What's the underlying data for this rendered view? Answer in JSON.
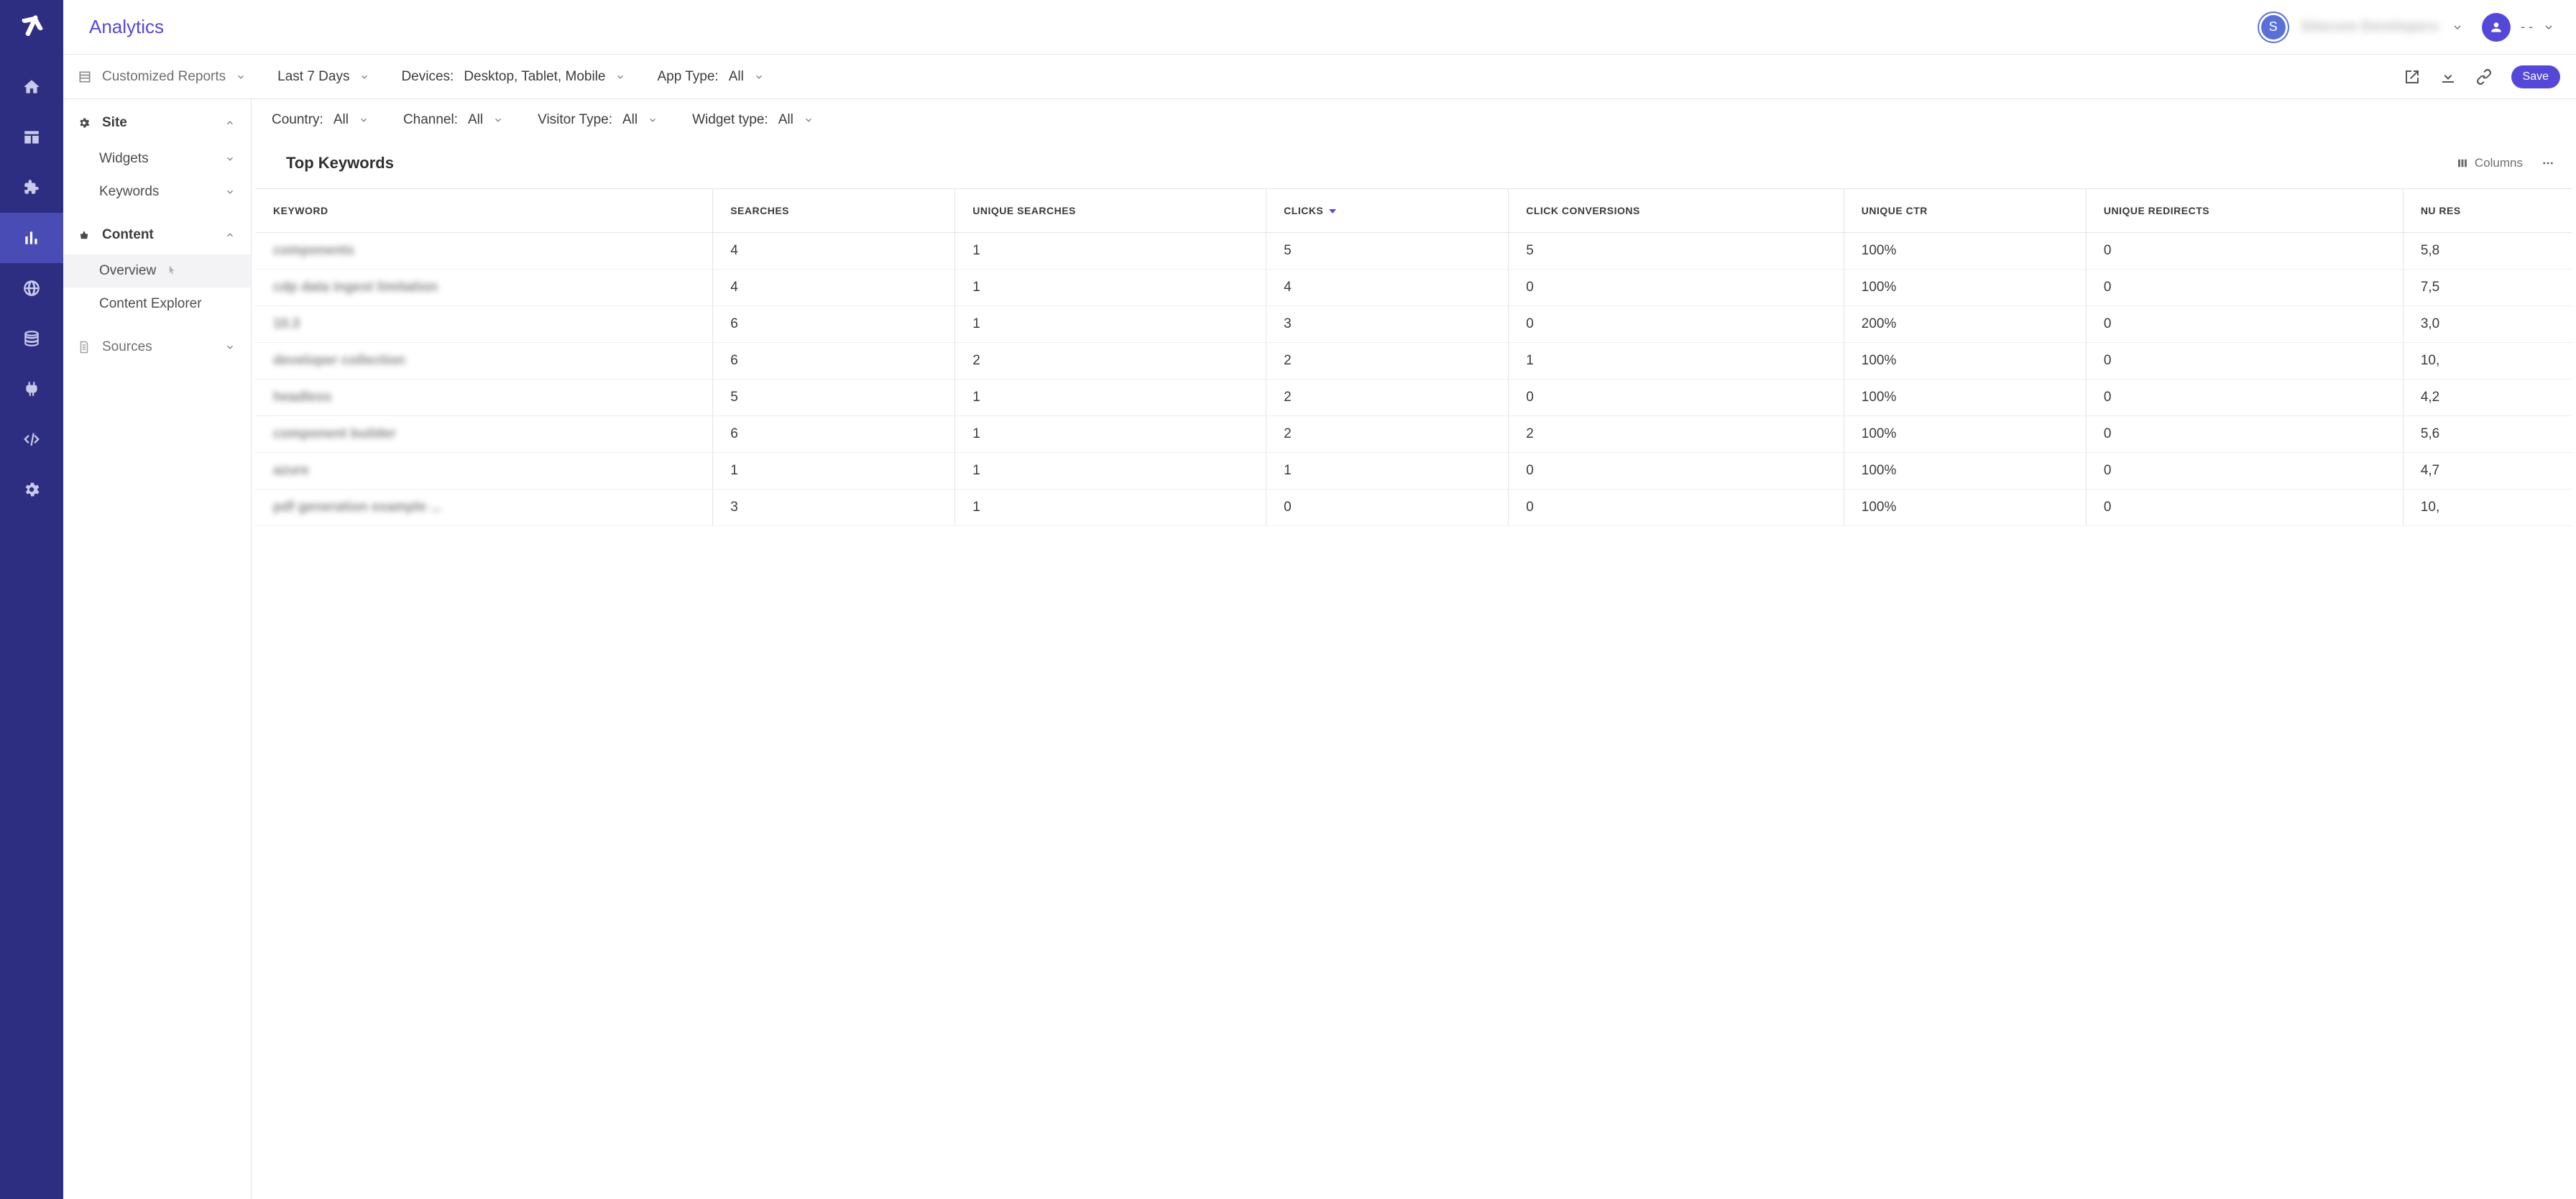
{
  "header": {
    "title": "Analytics",
    "avatar_letter": "S",
    "org_name": "Sitecore Developers",
    "user_label": "- -"
  },
  "toolbar": {
    "reports_label": "Customized Reports",
    "daterange": "Last 7 Days",
    "devices_label": "Devices:",
    "devices_value": "Desktop, Tablet, Mobile",
    "apptype_label": "App Type:",
    "apptype_value": "All",
    "save_label": "Save"
  },
  "sidebar": {
    "site": "Site",
    "widgets": "Widgets",
    "keywords": "Keywords",
    "content": "Content",
    "overview": "Overview",
    "content_explorer": "Content Explorer",
    "sources": "Sources"
  },
  "filters": {
    "country_label": "Country:",
    "country_value": "All",
    "channel_label": "Channel:",
    "channel_value": "All",
    "visitor_label": "Visitor Type:",
    "visitor_value": "All",
    "widget_label": "Widget type:",
    "widget_value": "All"
  },
  "panel": {
    "title": "Top Keywords",
    "columns_label": "Columns"
  },
  "table": {
    "headers": {
      "keyword": "KEYWORD",
      "searches": "SEARCHES",
      "unique_searches": "UNIQUE SEARCHES",
      "clicks": "CLICKS",
      "click_conversions": "CLICK CONVERSIONS",
      "unique_ctr": "UNIQUE CTR",
      "unique_redirects": "UNIQUE REDIRECTS",
      "nu_res": "NU RES"
    },
    "rows": [
      {
        "keyword": "components",
        "searches": "4",
        "unique_searches": "1",
        "clicks": "5",
        "click_conversions": "5",
        "unique_ctr": "100%",
        "unique_redirects": "0",
        "nu_res": "5,8"
      },
      {
        "keyword": "cdp data ingest limitation",
        "searches": "4",
        "unique_searches": "1",
        "clicks": "4",
        "click_conversions": "0",
        "unique_ctr": "100%",
        "unique_redirects": "0",
        "nu_res": "7,5"
      },
      {
        "keyword": "10.3",
        "searches": "6",
        "unique_searches": "1",
        "clicks": "3",
        "click_conversions": "0",
        "unique_ctr": "200%",
        "unique_redirects": "0",
        "nu_res": "3,0"
      },
      {
        "keyword": "developer collection",
        "searches": "6",
        "unique_searches": "2",
        "clicks": "2",
        "click_conversions": "1",
        "unique_ctr": "100%",
        "unique_redirects": "0",
        "nu_res": "10,"
      },
      {
        "keyword": "headless",
        "searches": "5",
        "unique_searches": "1",
        "clicks": "2",
        "click_conversions": "0",
        "unique_ctr": "100%",
        "unique_redirects": "0",
        "nu_res": "4,2"
      },
      {
        "keyword": "component builder",
        "searches": "6",
        "unique_searches": "1",
        "clicks": "2",
        "click_conversions": "2",
        "unique_ctr": "100%",
        "unique_redirects": "0",
        "nu_res": "5,6"
      },
      {
        "keyword": "azure",
        "searches": "1",
        "unique_searches": "1",
        "clicks": "1",
        "click_conversions": "0",
        "unique_ctr": "100%",
        "unique_redirects": "0",
        "nu_res": "4,7"
      },
      {
        "keyword": "pdf generation example ...",
        "searches": "3",
        "unique_searches": "1",
        "clicks": "0",
        "click_conversions": "0",
        "unique_ctr": "100%",
        "unique_redirects": "0",
        "nu_res": "10,"
      }
    ]
  }
}
